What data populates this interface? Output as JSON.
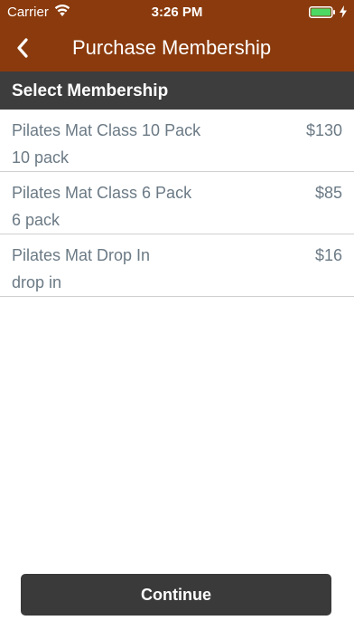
{
  "status_bar": {
    "carrier": "Carrier",
    "time": "3:26 PM"
  },
  "nav": {
    "title": "Purchase Membership"
  },
  "section": {
    "title": "Select Membership"
  },
  "memberships": [
    {
      "name": "Pilates Mat Class 10 Pack",
      "subtitle": "10 pack",
      "price": "$130"
    },
    {
      "name": "Pilates Mat Class 6 Pack",
      "subtitle": "6 pack",
      "price": "$85"
    },
    {
      "name": "Pilates Mat Drop In",
      "subtitle": "drop in",
      "price": "$16"
    }
  ],
  "footer": {
    "continue_label": "Continue"
  },
  "colors": {
    "header_bg": "#8a3a0c",
    "section_bg": "#3d3d3d",
    "button_bg": "#3a3a3a",
    "item_text": "#6b7a85",
    "battery_fill": "#4cd964"
  }
}
